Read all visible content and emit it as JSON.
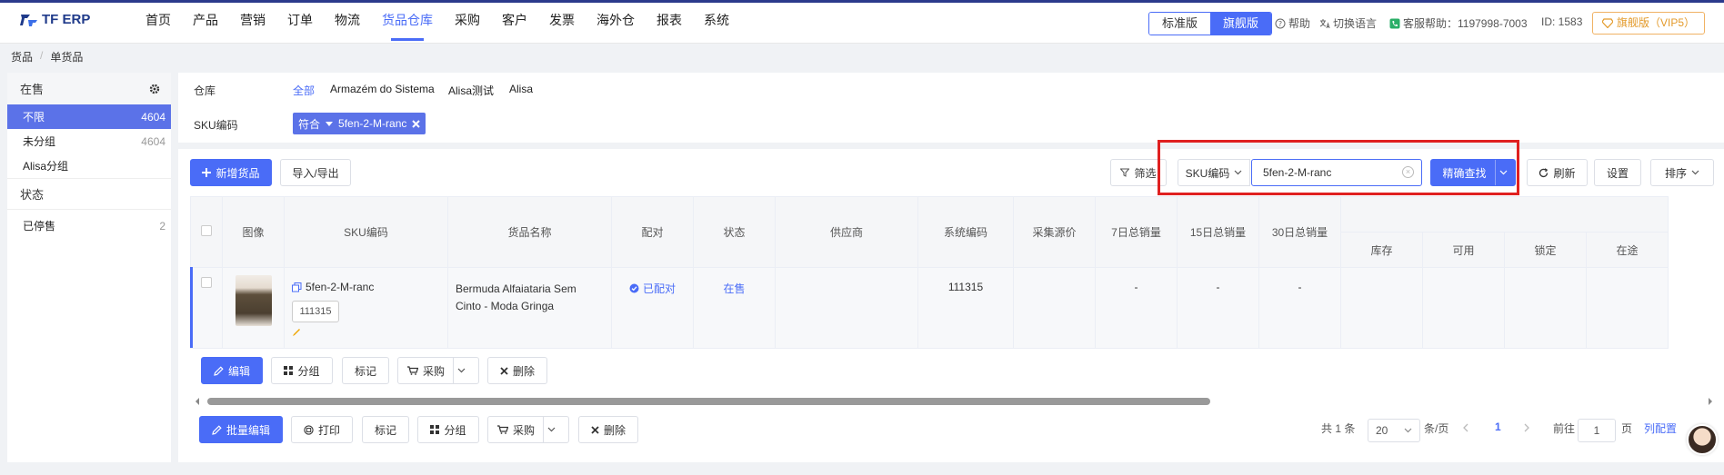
{
  "app": {
    "logo_text": "TF ERP",
    "nav": [
      "首页",
      "产品",
      "营销",
      "订单",
      "物流",
      "货品仓库",
      "采购",
      "客户",
      "发票",
      "海外仓",
      "报表",
      "系统"
    ],
    "nav_active": "货品仓库",
    "editions": {
      "standard": "标准版",
      "flagship": "旗舰版"
    },
    "help": "帮助",
    "lang": "切换语言",
    "support": "客服帮助：1197998-7003",
    "user_id": "ID: 1583",
    "vip": "旗舰版（VIP5）"
  },
  "breadcrumb": [
    "货品",
    "单货品"
  ],
  "sidebar": {
    "on_sale_header": "在售",
    "items": [
      {
        "label": "不限",
        "count": "4604"
      },
      {
        "label": "未分组",
        "count": "4604"
      },
      {
        "label": "Alisa分组",
        "count": ""
      }
    ],
    "status_header": "状态",
    "status_items": [
      {
        "label": "已停售",
        "count": "2"
      }
    ]
  },
  "filters": {
    "warehouse_label": "仓库",
    "warehouses": [
      "全部",
      "Armazém do Sistema",
      "Alisa测试",
      "Alisa"
    ],
    "sku_label": "SKU编码",
    "tag_op": "符合",
    "tag_value": "5fen-2-M-ranc"
  },
  "toolbar": {
    "add": "新增货品",
    "import_export": "导入/导出",
    "filter": "筛选",
    "search_field": "SKU编码",
    "search_value": "5fen-2-M-ranc",
    "exact_search": "精确查找",
    "refresh": "刷新",
    "settings": "设置",
    "sort": "排序"
  },
  "table": {
    "headers": [
      "图像",
      "SKU编码",
      "货品名称",
      "配对",
      "状态",
      "供应商",
      "系统编码",
      "采集源价",
      "7日总销量",
      "15日总销量",
      "30日总销量"
    ],
    "sub_headers": [
      "库存",
      "可用",
      "锁定",
      "在途"
    ],
    "rows": [
      {
        "sku": "5fen-2-M-ranc",
        "sys_code_box": "111315",
        "name": "Bermuda Alfaiataria Sem Cinto - Moda Gringa",
        "match": "已配对",
        "status": "在售",
        "supplier": "",
        "sys_code": "111315",
        "source_price": "",
        "sales7": "-",
        "sales15": "-",
        "sales30": "-"
      }
    ]
  },
  "row_actions": {
    "edit": "编辑",
    "group": "分组",
    "mark": "标记",
    "purchase": "采购",
    "delete": "删除"
  },
  "bulk_actions": {
    "bulk_edit": "批量编辑",
    "print": "打印",
    "mark": "标记",
    "group": "分组",
    "purchase": "采购",
    "delete": "删除"
  },
  "pagination": {
    "total": "共 1 条",
    "page_size": "20",
    "per_page": "条/页",
    "current": "1",
    "goto": "前往",
    "goto_value": "1",
    "page_unit": "页",
    "columns": "列配置"
  },
  "colors": {
    "accent": "#4a6cf7",
    "highlight": "#e02020",
    "vip": "#e39a2a"
  }
}
